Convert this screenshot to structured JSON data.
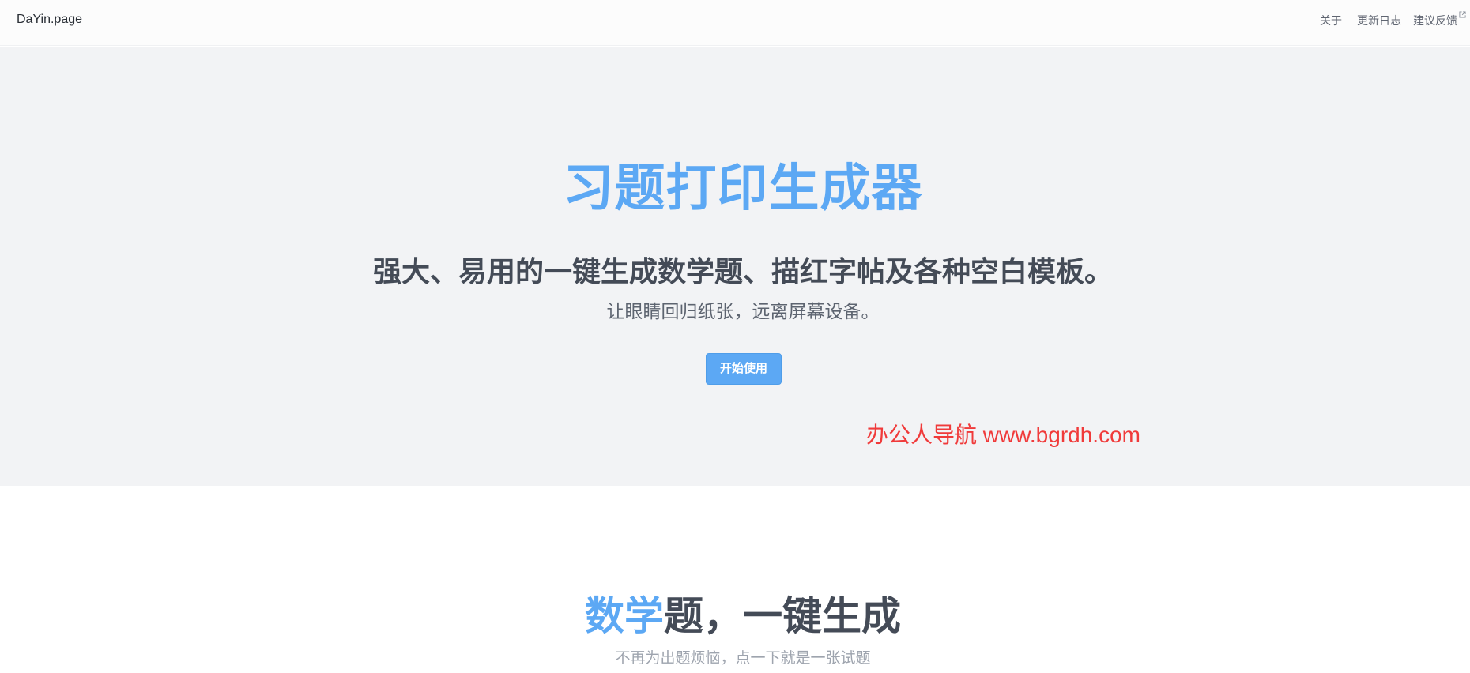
{
  "navbar": {
    "brand": "DaYin.page",
    "links": [
      {
        "label": "关于"
      },
      {
        "label": "更新日志"
      },
      {
        "label": "建议反馈",
        "icon": "external-link-icon"
      }
    ]
  },
  "hero": {
    "title": "习题打印生成器",
    "subtitle": "强大、易用的一键生成数学题、描红字帖及各种空白模板。",
    "tagline": "让眼睛回归纸张，远离屏幕设备。",
    "cta_label": "开始使用",
    "watermark": "办公人导航 www.bgrdh.com"
  },
  "math_section": {
    "title_accent": "数学",
    "title_rest": "题，一键生成",
    "description": "不再为出题烦恼，点一下就是一张试题"
  },
  "colors": {
    "accent": "#5ca8f4",
    "heading": "#444b57",
    "hero_background": "#f2f3f5",
    "watermark": "#f03a3a"
  }
}
